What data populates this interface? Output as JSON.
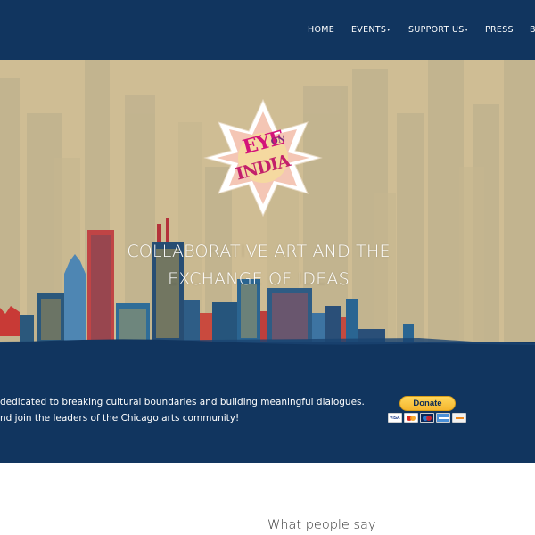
{
  "nav": {
    "items": [
      {
        "label": "HOME"
      },
      {
        "label": "EVENTS",
        "caret": "▾"
      },
      {
        "label": "SUPPORT US",
        "caret": "▾"
      },
      {
        "label": "PRESS"
      },
      {
        "label": "B"
      }
    ]
  },
  "logo": {
    "line1": "EYE",
    "line2": "ON",
    "line3": "INDIA"
  },
  "hero": {
    "tagline_line1": "COLLABORATIVE ART AND THE",
    "tagline_line2": "EXCHANGE OF IDEAS"
  },
  "banner": {
    "line1": "dedicated to breaking cultural boundaries and building meaningful dialogues.",
    "line2": "nd join the leaders of the Chicago arts community!"
  },
  "donate": {
    "label": "Donate",
    "cards": [
      "visa-icon",
      "mastercard-icon",
      "maestro-icon",
      "amex-icon",
      "discover-icon"
    ]
  },
  "testimonials": {
    "title": "What people say"
  },
  "colors": {
    "navy": "#11355f",
    "hero_bg": "#cfbd94",
    "donate_yellow": "#fcc439"
  }
}
